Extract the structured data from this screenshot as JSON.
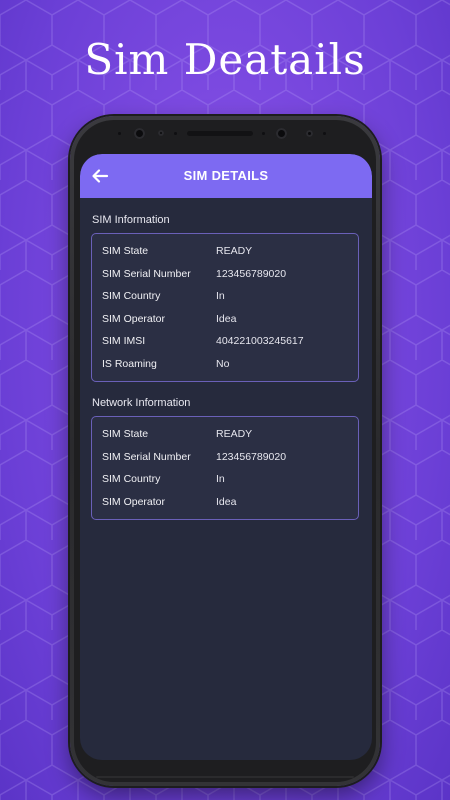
{
  "promo": {
    "title": "Sim Deatails"
  },
  "app_bar": {
    "title": "SIM DETAILS",
    "back_icon": "arrow-left-icon"
  },
  "sim_information": {
    "title": "SIM Information",
    "rows": [
      {
        "label": "SIM State",
        "value": "READY"
      },
      {
        "label": "SIM Serial Number",
        "value": "123456789020"
      },
      {
        "label": "SIM Country",
        "value": "In"
      },
      {
        "label": "SIM Operator",
        "value": "Idea"
      },
      {
        "label": "SIM IMSI",
        "value": "404221003245617"
      },
      {
        "label": "IS Roaming",
        "value": "No"
      }
    ]
  },
  "network_information": {
    "title": "Network Information",
    "rows": [
      {
        "label": "SIM State",
        "value": "READY"
      },
      {
        "label": "SIM Serial Number",
        "value": "123456789020"
      },
      {
        "label": "SIM Country",
        "value": "In"
      },
      {
        "label": "SIM Operator",
        "value": "Idea"
      }
    ]
  },
  "colors": {
    "background": "#7b49e0",
    "app_bar": "#7d6af2",
    "screen": "#262a3d",
    "card_border": "#6a60b8"
  }
}
